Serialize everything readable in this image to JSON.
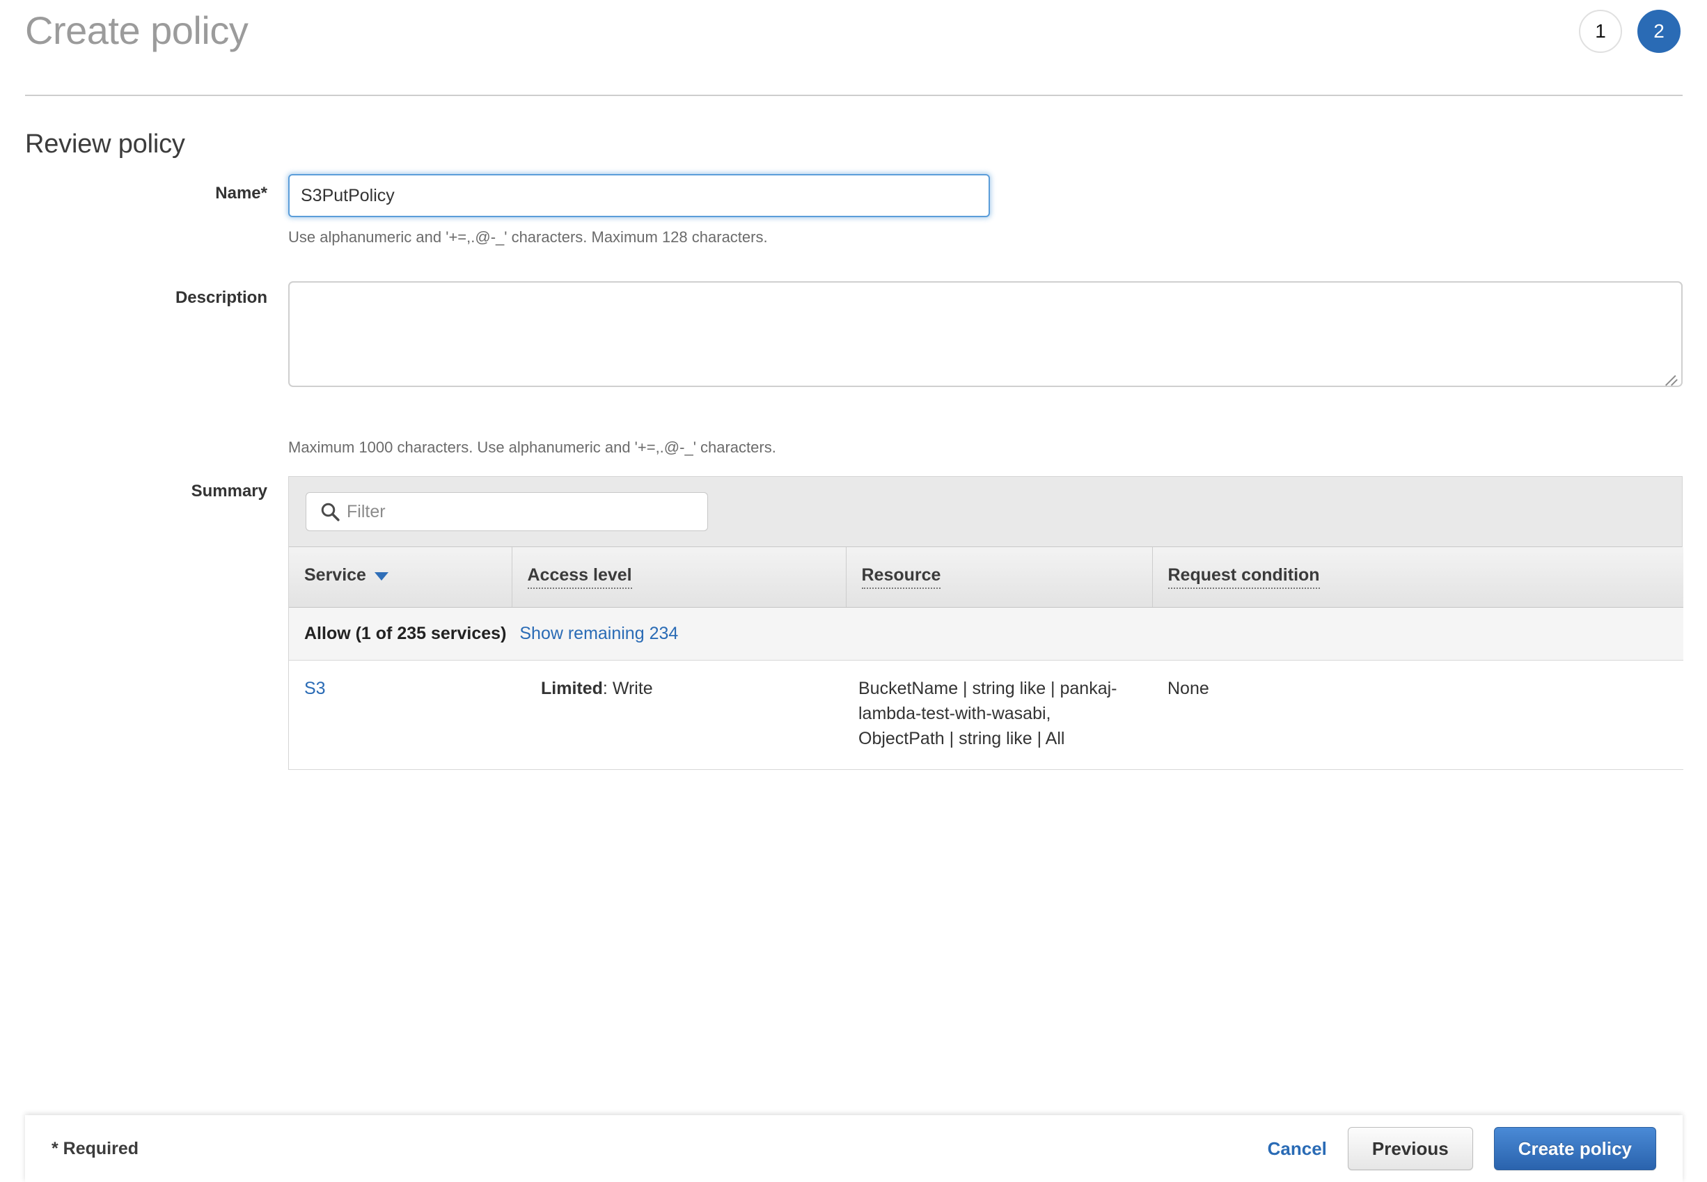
{
  "header": {
    "title": "Create policy",
    "steps": [
      {
        "label": "1",
        "state": "inactive"
      },
      {
        "label": "2",
        "state": "active"
      }
    ]
  },
  "section": {
    "title": "Review policy"
  },
  "form": {
    "name": {
      "label": "Name*",
      "value": "S3PutPolicy",
      "placeholder": "",
      "helper": "Use alphanumeric and '+=,.@-_' characters. Maximum 128 characters."
    },
    "description": {
      "label": "Description",
      "value": "",
      "placeholder": "",
      "helper": "Maximum 1000 characters. Use alphanumeric and '+=,.@-_' characters."
    },
    "summary": {
      "label": "Summary",
      "filter_placeholder": "Filter",
      "filter_value": "",
      "search_icon": "search-icon",
      "columns": [
        {
          "label": "Service",
          "sorted": true,
          "dotted": false
        },
        {
          "label": "Access level",
          "sorted": false,
          "dotted": true
        },
        {
          "label": "Resource",
          "sorted": false,
          "dotted": true
        },
        {
          "label": "Request condition",
          "sorted": false,
          "dotted": true
        }
      ],
      "group": {
        "title": "Allow (1 of 235 services)",
        "link": "Show remaining 234"
      },
      "rows": [
        {
          "service": "S3",
          "access_level_prefix": "Limited",
          "access_level_value": "Write",
          "resource": "BucketName | string like | pankaj-lambda-test-with-wasabi, ObjectPath | string like | All",
          "request_condition": "None"
        }
      ]
    }
  },
  "footer": {
    "required_note": "* Required",
    "cancel_label": "Cancel",
    "previous_label": "Previous",
    "create_label": "Create policy"
  },
  "colors": {
    "accent_blue": "#2a6bb5",
    "link_blue": "#2a6bb5",
    "title_gray": "#9b9b9b",
    "focus_ring": "#5b9dd9"
  }
}
